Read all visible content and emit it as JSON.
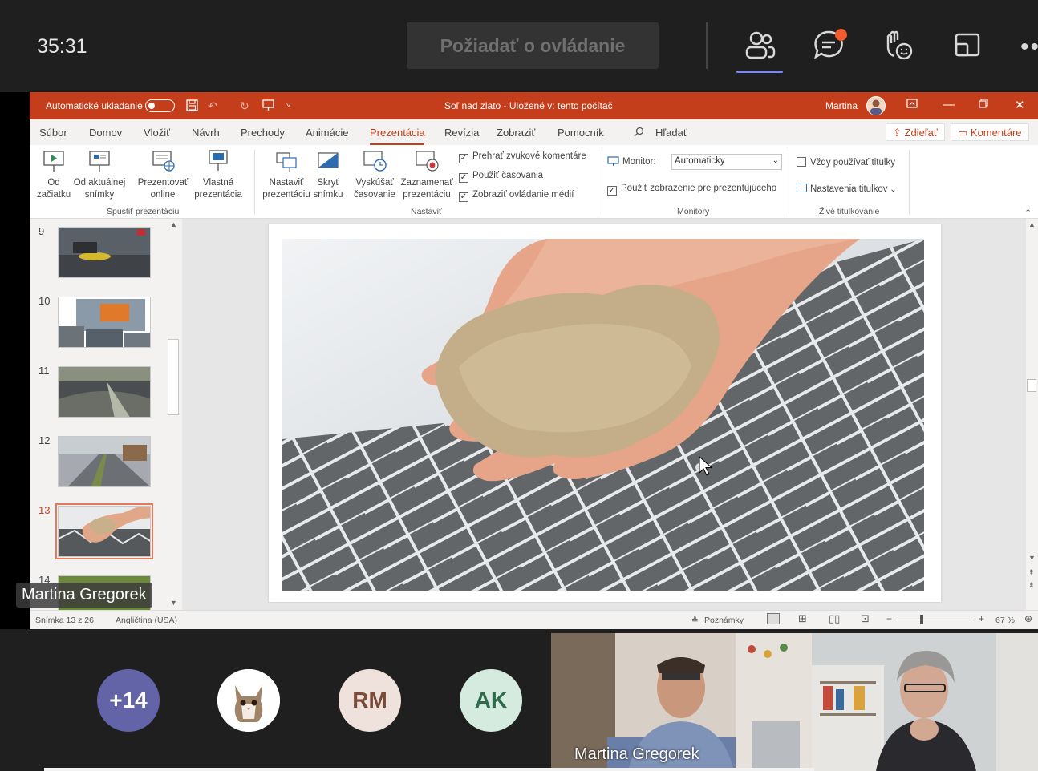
{
  "teams": {
    "timer": "35:31",
    "request_control": "Požiadať o ovládanie",
    "icons": [
      "people-icon",
      "chat-icon",
      "raise-hand-icon",
      "share-tray-icon",
      "more-icon"
    ]
  },
  "ppt": {
    "autosave_label": "Automatické ukladanie",
    "doc_title": "Soľ nad zlato  -  Uložené v: tento počítač",
    "user": "Martina",
    "tabs": [
      "Súbor",
      "Domov",
      "Vložiť",
      "Návrh",
      "Prechody",
      "Animácie",
      "Prezentácia",
      "Revízia",
      "Zobraziť",
      "Pomocník"
    ],
    "active_tab": "Prezentácia",
    "search": "Hľadať",
    "share": "Zdieľať",
    "comments": "Komentáre",
    "ribbon": {
      "from_start": "Od začiatku",
      "from_current": "Od aktuálnej snímky",
      "present_online": "Prezentovať online",
      "custom_show": "Vlastná prezentácia",
      "group_start": "Spustiť prezentáciu",
      "setup": "Nastaviť prezentáciu",
      "hide_slide": "Skryť snímku",
      "rehearse": "Vyskúšať časovanie",
      "record": "Zaznamenať prezentáciu",
      "play_narrations": "Prehrať zvukové komentáre",
      "use_timings": "Použiť časovania",
      "show_media": "Zobraziť ovládanie médií",
      "group_setup": "Nastaviť",
      "monitor_label": "Monitor:",
      "monitor_value": "Automaticky",
      "presenter_view": "Použiť zobrazenie pre prezentujúceho",
      "group_monitors": "Monitory",
      "always_subtitles": "Vždy používať titulky",
      "subtitle_settings": "Nastavenia titulkov",
      "group_captions": "Živé titulkovanie"
    },
    "slides": [
      "9",
      "10",
      "11",
      "12",
      "13",
      "14"
    ],
    "selected_slide": "13",
    "status": {
      "slide_count": "Snímka 13 z 26",
      "language": "Angličtina (USA)",
      "notes": "Poznámky",
      "zoom": "67 %"
    }
  },
  "presenter_name": "Martina Gregorek",
  "participants": {
    "overflow": "+14",
    "initials1": "RM",
    "initials2": "AK",
    "video_name": "Martina Gregorek"
  },
  "colors": {
    "ppt_accent": "#c43e1c",
    "teams_accent": "#7f85f5",
    "overflow_bg": "#6264a7",
    "rm_bg": "#efe2dc",
    "ak_bg": "#d5ebdf"
  }
}
